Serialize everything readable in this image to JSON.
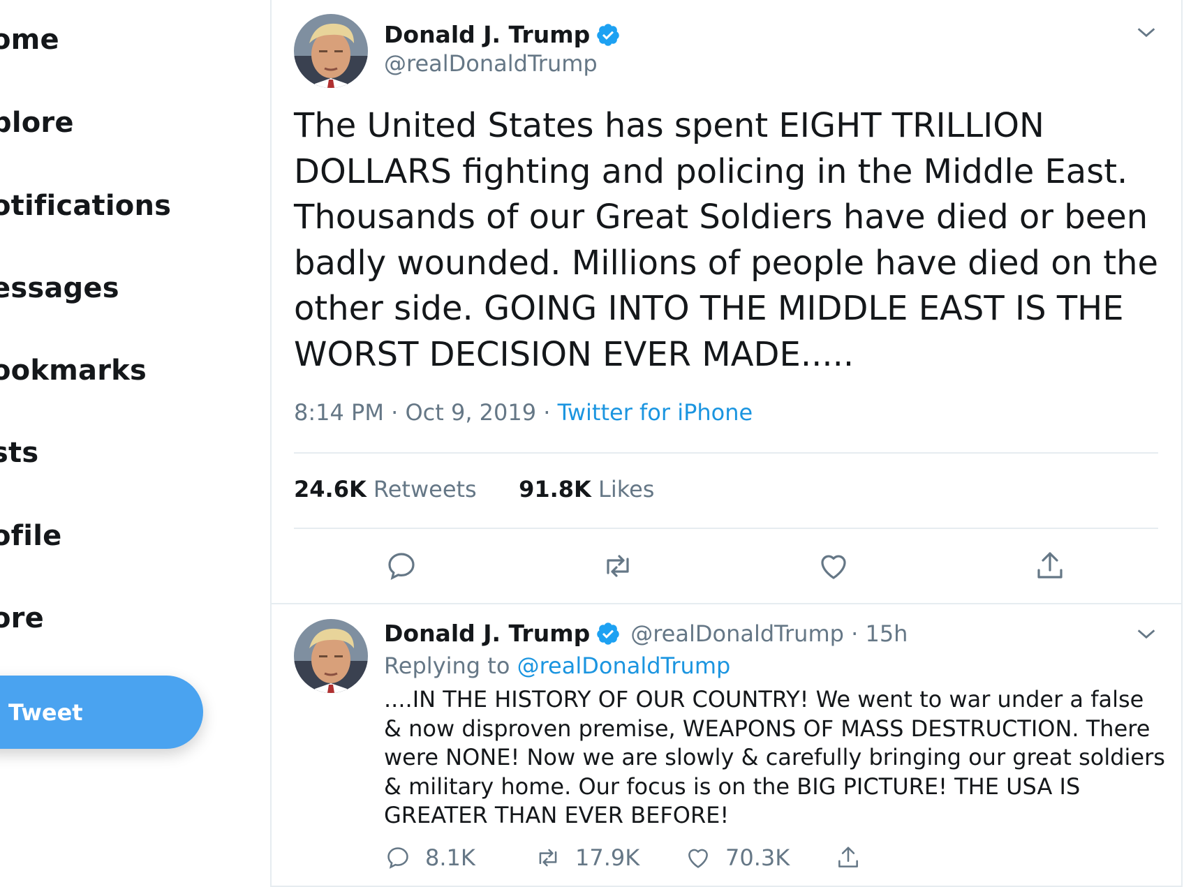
{
  "sidebar": {
    "items": [
      {
        "label": "ome"
      },
      {
        "label": "plore"
      },
      {
        "label": "otifications"
      },
      {
        "label": "essages"
      },
      {
        "label": "ookmarks"
      },
      {
        "label": "sts"
      },
      {
        "label": "ofile"
      },
      {
        "label": "ore"
      }
    ],
    "tweet_button": "Tweet",
    "accent": "#4aa3f0"
  },
  "main_tweet": {
    "name": "Donald J. Trump",
    "handle": "@realDonaldTrump",
    "text": "The United States has spent EIGHT TRILLION DOLLARS fighting and policing in the Middle East. Thousands of our Great Soldiers have died or been badly wounded. Millions of people have died on the other side. GOING INTO THE MIDDLE EAST IS THE WORST DECISION EVER MADE.....",
    "time": "8:14 PM · Oct 9, 2019 · ",
    "source": "Twitter for iPhone",
    "retweets_count": "24.6K",
    "retweets_label": "Retweets",
    "likes_count": "91.8K",
    "likes_label": "Likes"
  },
  "reply_tweet": {
    "name": "Donald J. Trump",
    "handle_time": "@realDonaldTrump · 15h",
    "replying_prefix": "Replying to ",
    "replying_to": "@realDonaldTrump",
    "text": "....IN THE HISTORY OF OUR COUNTRY! We went to war under a false & now disproven premise, WEAPONS OF MASS DESTRUCTION. There were NONE! Now we are slowly & carefully bringing our great soldiers & military home. Our focus is on the BIG PICTURE! THE USA IS GREATER THAN EVER BEFORE!",
    "replies": "8.1K",
    "retweets": "17.9K",
    "likes": "70.3K"
  },
  "colors": {
    "link": "#1b95e0",
    "muted": "#657786",
    "verified": "#1da1f2"
  }
}
